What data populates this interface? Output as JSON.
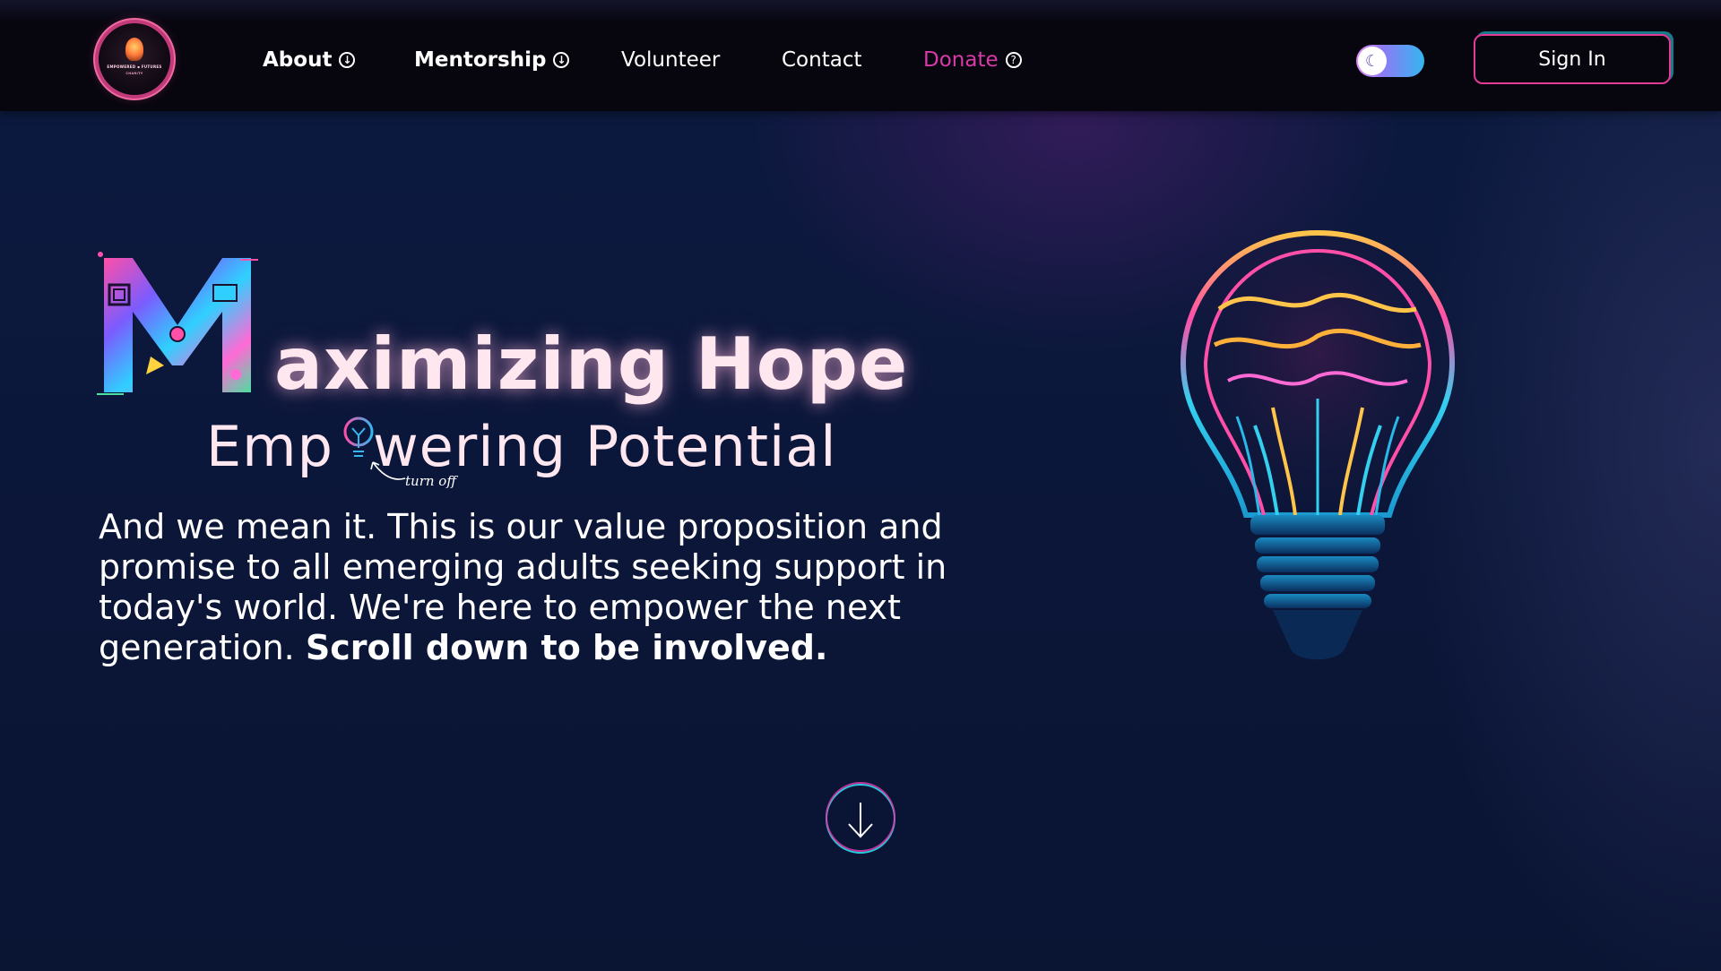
{
  "nav": {
    "logo": {
      "line1": "EMPOWERED ▪ FUTURES",
      "line2": "CHARITY"
    },
    "items": [
      {
        "label": "About",
        "icon": "arrow-down-circle-icon"
      },
      {
        "label": "Mentorship",
        "icon": "arrow-down-circle-icon"
      },
      {
        "label": "Volunteer"
      },
      {
        "label": "Contact"
      },
      {
        "label": "Donate",
        "icon": "question-circle-icon"
      }
    ],
    "theme_toggle": {
      "icon": "moon-icon"
    },
    "sign_in": "Sign In"
  },
  "hero": {
    "headline_rest": "aximizing Hope",
    "sub_before": "Emp",
    "sub_after": "wering Potential",
    "bulb_hint": "turn off",
    "paragraph": "And we mean it. This is our value proposition and promise to all emerging adults seeking support in today's world. We're here to empower the next generation.",
    "paragraph_bold": "Scroll down to be involved.",
    "scroll_icon": "arrow-down-icon"
  },
  "colors": {
    "background": "#0b1638",
    "nav_background": "#07060f",
    "accent_pink": "#e33a96",
    "accent_cyan": "#28c8dc",
    "donate": "#d93aa8"
  }
}
